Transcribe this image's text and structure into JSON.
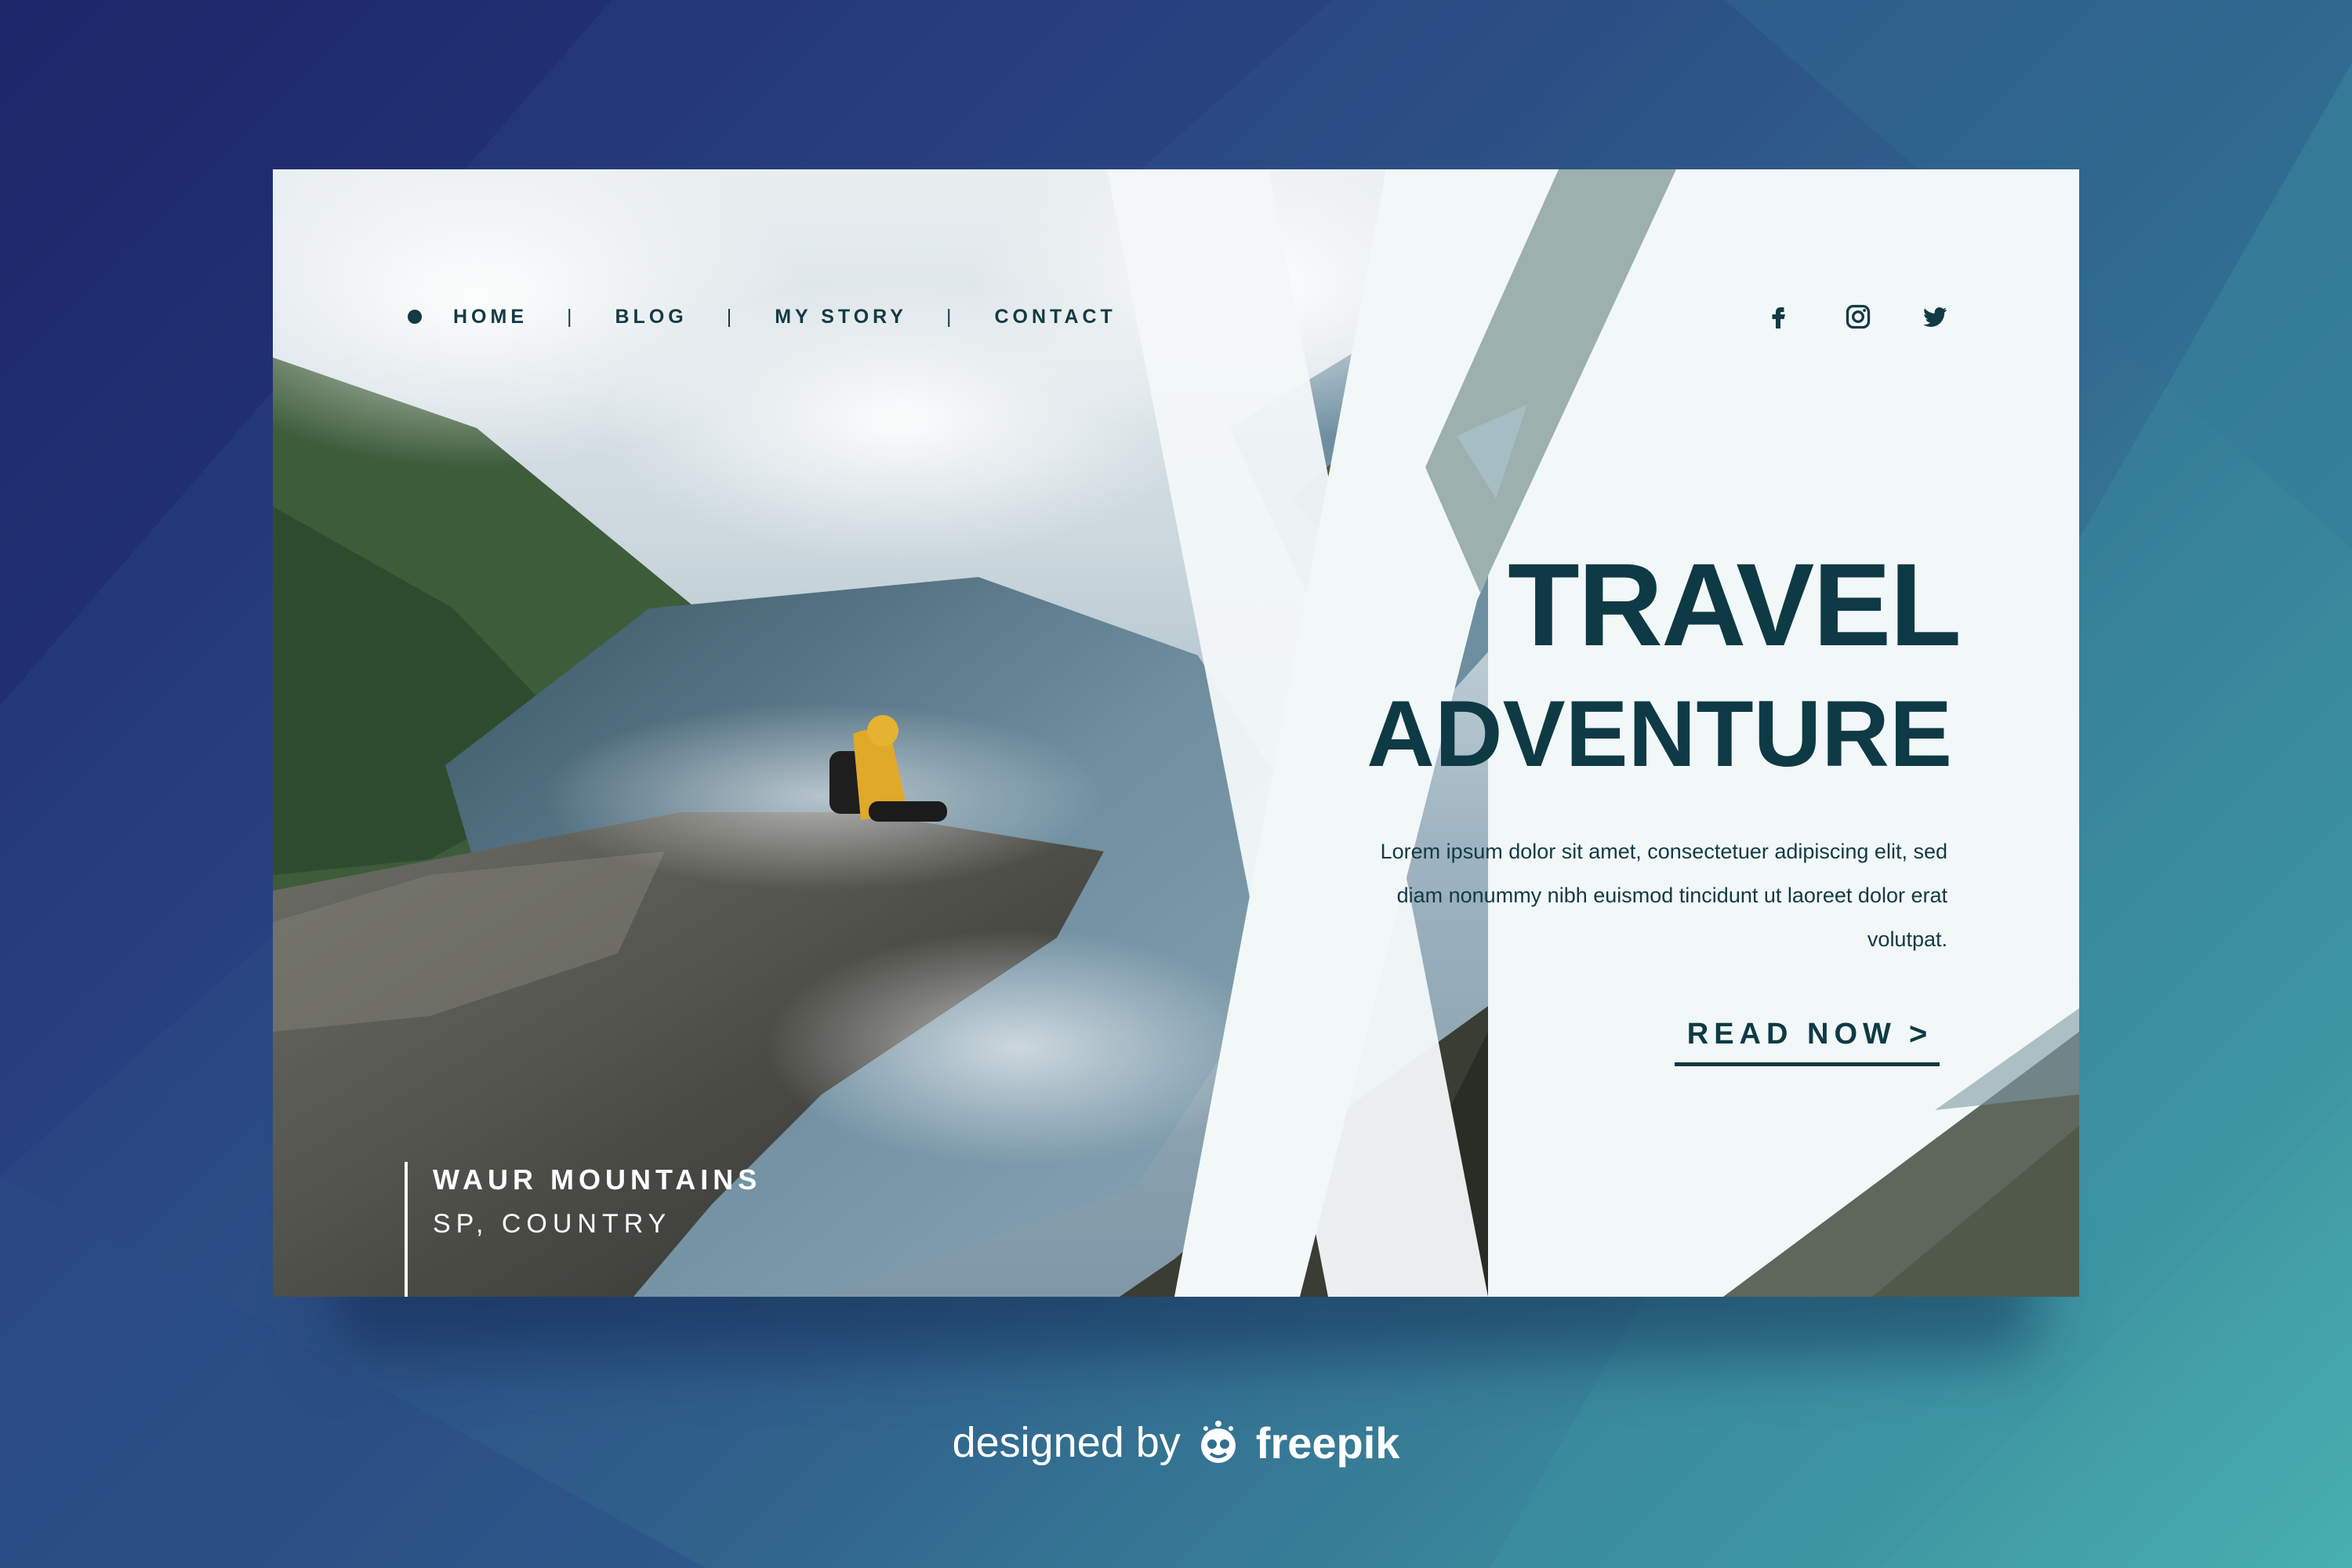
{
  "nav": {
    "items": [
      {
        "label": "HOME"
      },
      {
        "label": "BLOG"
      },
      {
        "label": "MY STORY"
      },
      {
        "label": "CONTACT"
      }
    ],
    "separator": "|"
  },
  "social": [
    "facebook-icon",
    "instagram-icon",
    "twitter-icon"
  ],
  "hero": {
    "title_line1": "TRAVEL",
    "title_line2": "ADVENTURE",
    "body": "Lorem ipsum dolor sit amet, consectetuer adipiscing elit, sed diam nonummy nibh euismod tincidunt ut laoreet dolor erat volutpat.",
    "cta_label": "READ NOW",
    "cta_icon": ">"
  },
  "location": {
    "name": "WAUR MOUNTAINS",
    "country": "SP, COUNTRY"
  },
  "credit": {
    "prefix": "designed by",
    "brand": "freepik"
  },
  "colors": {
    "text_dark": "#0e3a45",
    "panel": "#f2f7f8",
    "background_start": "#1b2467",
    "background_end": "#48b0b0"
  }
}
